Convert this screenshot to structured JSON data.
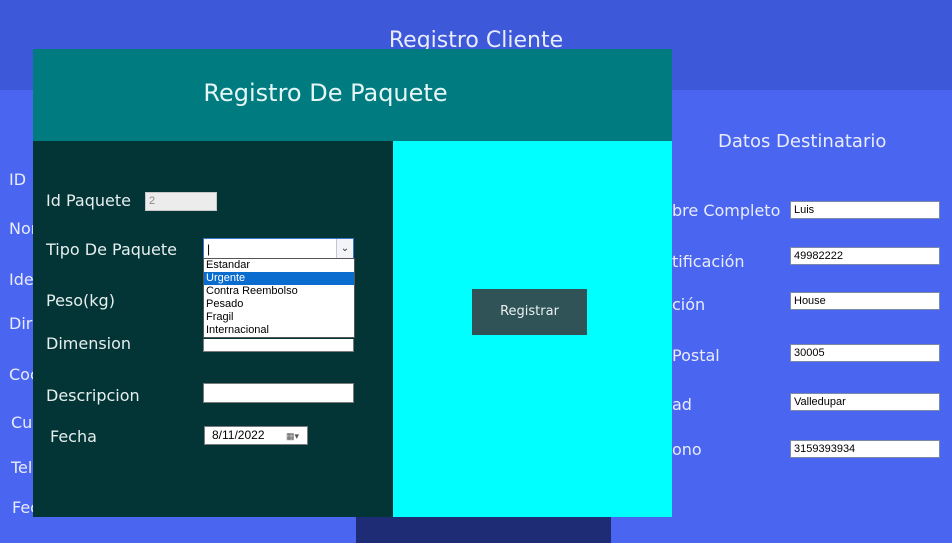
{
  "background_window": {
    "title": "Registro Cliente",
    "left_labels": [
      "ID",
      "Nor",
      "Ide",
      "Dire",
      "Coc",
      "Cu",
      "Tel",
      "Fec"
    ],
    "destinatario_title": "Datos Destinatario",
    "destinatario_fields": [
      {
        "label": "bre Completo",
        "value": "Luis"
      },
      {
        "label": "tificación",
        "value": "49982222"
      },
      {
        "label": "ción",
        "value": "House"
      },
      {
        "label": "Postal",
        "value": "30005"
      },
      {
        "label": "ad",
        "value": "Valledupar"
      },
      {
        "label": "ono",
        "value": "3159393934"
      }
    ]
  },
  "dialog": {
    "title": "Registro De Paquete",
    "id_label": "Id Paquete",
    "id_value": "2",
    "tipo_label": "Tipo De Paquete",
    "tipo_value": "|",
    "tipo_options": [
      "Estandar",
      "Urgente",
      "Contra Reembolso",
      "Pesado",
      "Fragil",
      "Internacional"
    ],
    "tipo_highlighted": "Urgente",
    "peso_label": "Peso(kg)",
    "dimension_label": "Dimension",
    "descripcion_label": "Descripcion",
    "fecha_label": "Fecha",
    "fecha_value": "8/11/2022",
    "registrar_label": "Registrar"
  },
  "icons": {
    "combo_arrow": "chevron-down-icon",
    "calendar": "calendar-icon"
  },
  "colors": {
    "header_teal": "#007c80",
    "panel_dark": "#033536",
    "panel_cyan": "#00ffff",
    "bg_blue": "#4a65ef",
    "selection": "#0a6ccf"
  }
}
